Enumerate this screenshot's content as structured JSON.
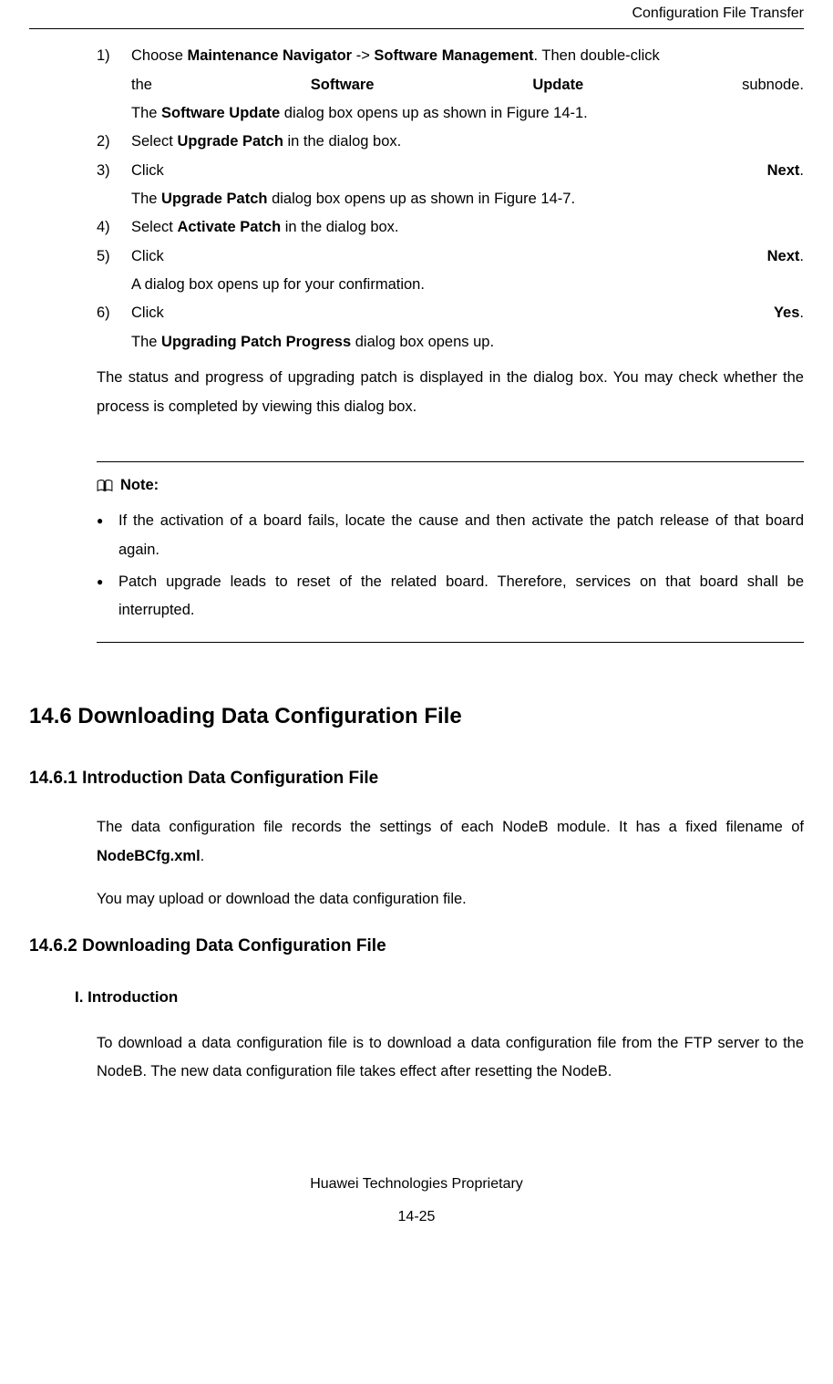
{
  "header": {
    "title": "Configuration File Transfer"
  },
  "steps": {
    "s1": {
      "num": "1)",
      "line1_pre": "Choose ",
      "line1_b1": "Maintenance Navigator",
      "line1_mid": " -> ",
      "line1_b2": "Software Management",
      "line1_post": ". Then double-click",
      "line2_pre": "the",
      "line2_b1": "Software",
      "line2_b2": "Update",
      "line2_post": "subnode.",
      "line3_pre": "The ",
      "line3_b": "Software Update",
      "line3_post": " dialog box opens up as shown in Figure 14-1."
    },
    "s2": {
      "num": "2)",
      "pre": "Select ",
      "b": "Upgrade Patch",
      "post": " in the dialog box."
    },
    "s3": {
      "num": "3)",
      "line1_pre": "Click",
      "line1_b": "Next",
      "line1_post": ".",
      "line2_pre": "The ",
      "line2_b": "Upgrade Patch",
      "line2_post": " dialog box opens up as shown in Figure 14-7."
    },
    "s4": {
      "num": "4)",
      "pre": "Select ",
      "b": "Activate Patch",
      "post": " in the dialog box."
    },
    "s5": {
      "num": "5)",
      "line1_pre": "Click",
      "line1_b": "Next",
      "line1_post": ".",
      "line2": "A dialog box opens up for your confirmation."
    },
    "s6": {
      "num": "6)",
      "line1_pre": "Click",
      "line1_b": "Yes",
      "line1_post": ".",
      "line2_pre": "The ",
      "line2_b": "Upgrading Patch Progress",
      "line2_post": " dialog box opens up."
    }
  },
  "para1": "The status and progress of upgrading patch is displayed in the dialog box. You may check whether the process is completed by viewing this dialog box.",
  "note": {
    "label": "Note:",
    "b1": "If the activation of a board fails, locate the cause and then activate the patch release of that board again.",
    "b2": "Patch upgrade leads to reset of the related board. Therefore, services on that board shall be interrupted."
  },
  "h2": "14.6  Downloading Data Configuration File",
  "h3a": "14.6.1  Introduction Data Configuration File",
  "p_intro1_pre": "The data configuration file records the settings of each NodeB module. It has a fixed filename of ",
  "p_intro1_b": "NodeBCfg.xml",
  "p_intro1_post": ".",
  "p_intro2": "You may upload or download the data configuration file.",
  "h3b": "14.6.2  Downloading Data Configuration File",
  "h4": "I. Introduction",
  "p_download": "To download a data configuration file is to download a data configuration file from the FTP server to the NodeB. The new data configuration file takes effect after resetting the NodeB.",
  "footer": {
    "line1": "Huawei Technologies Proprietary",
    "line2": "14-25"
  }
}
